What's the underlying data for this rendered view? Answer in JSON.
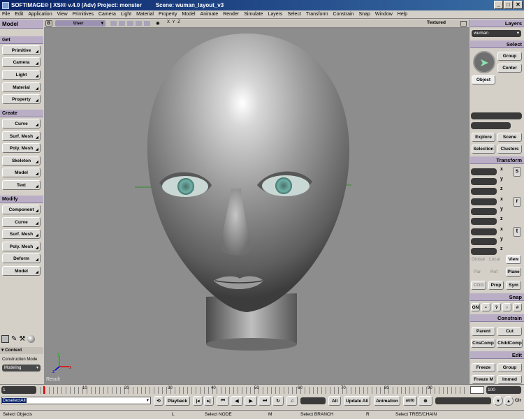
{
  "titlebar": {
    "app": "SOFTIMAGE® | XSI® v.4.0 (Adv) Project: monster",
    "scene": "Scene: wuman_layout_v3"
  },
  "menu": [
    "File",
    "Edit",
    "Application",
    "View",
    "Primitives",
    "Camera",
    "Light",
    "Material",
    "Property",
    "Model",
    "Animate",
    "Render",
    "Simulate",
    "Layers",
    "Select",
    "Transform",
    "Constrain",
    "Snap",
    "Window",
    "Help"
  ],
  "left": {
    "title": "Model",
    "get_header": "Get",
    "get_items": [
      "Primitive",
      "Camera",
      "Light",
      "Material",
      "Property"
    ],
    "create_header": "Create",
    "create_items": [
      "Curve",
      "Surf. Mesh",
      "Poly. Mesh",
      "Skeleton",
      "Model",
      "Text"
    ],
    "modify_header": "Modify",
    "modify_items": [
      "Component",
      "Curve",
      "Surf. Mesh",
      "Poly. Mesh",
      "Deform",
      "Model"
    ],
    "context_label": "Context",
    "construction_label": "Construction Mode",
    "construction_value": "Modeling"
  },
  "viewport": {
    "cam_letter": "B",
    "view_name": "User",
    "xyz": "X  Y  Z",
    "shading": "Textured",
    "result_label": "Result"
  },
  "right": {
    "layers_title": "Layers",
    "layer_value": "wuman",
    "select_title": "Select",
    "group": "Group",
    "center": "Center",
    "object": "Object",
    "explore": "Explore",
    "scene": "Scene",
    "selection": "Selection",
    "clusters": "Clusters",
    "transform_title": "Transform",
    "axes": [
      "x",
      "y",
      "z"
    ],
    "srt": [
      "s",
      "r",
      "t"
    ],
    "global": "Global",
    "local": "Local",
    "view": "View",
    "par": "Par",
    "ref": "Ref",
    "plane": "Plane",
    "cog": "COG",
    "prop": "Prop",
    "sym": "Sym",
    "snap_title": "Snap",
    "on": "ON",
    "constrain_title": "Constrain",
    "parent": "Parent",
    "cut": "Cut",
    "cnscomp": "CnsComp",
    "childcomp": "ChildComp",
    "edit_title": "Edit",
    "freeze": "Freeze",
    "group2": "Group",
    "freezem": "Freeze M",
    "immed": "Immed"
  },
  "timeline": {
    "start": "1",
    "ticks": [
      "10",
      "20",
      "30",
      "40",
      "50",
      "60",
      "70",
      "80",
      "90"
    ],
    "end_field": "100"
  },
  "playbar": {
    "cmd": "DeselectAll",
    "playback": "Playback",
    "all": "All",
    "update": "Update All",
    "animation": "Animation",
    "auto": "auto",
    "clr": "Clr"
  },
  "status": {
    "left": "Select Objects",
    "l": "L",
    "l_action": "Select NODE",
    "m": "M",
    "m_action": "Select BRANCH",
    "r": "R",
    "r_action": "Select TREE/CHAIN"
  }
}
